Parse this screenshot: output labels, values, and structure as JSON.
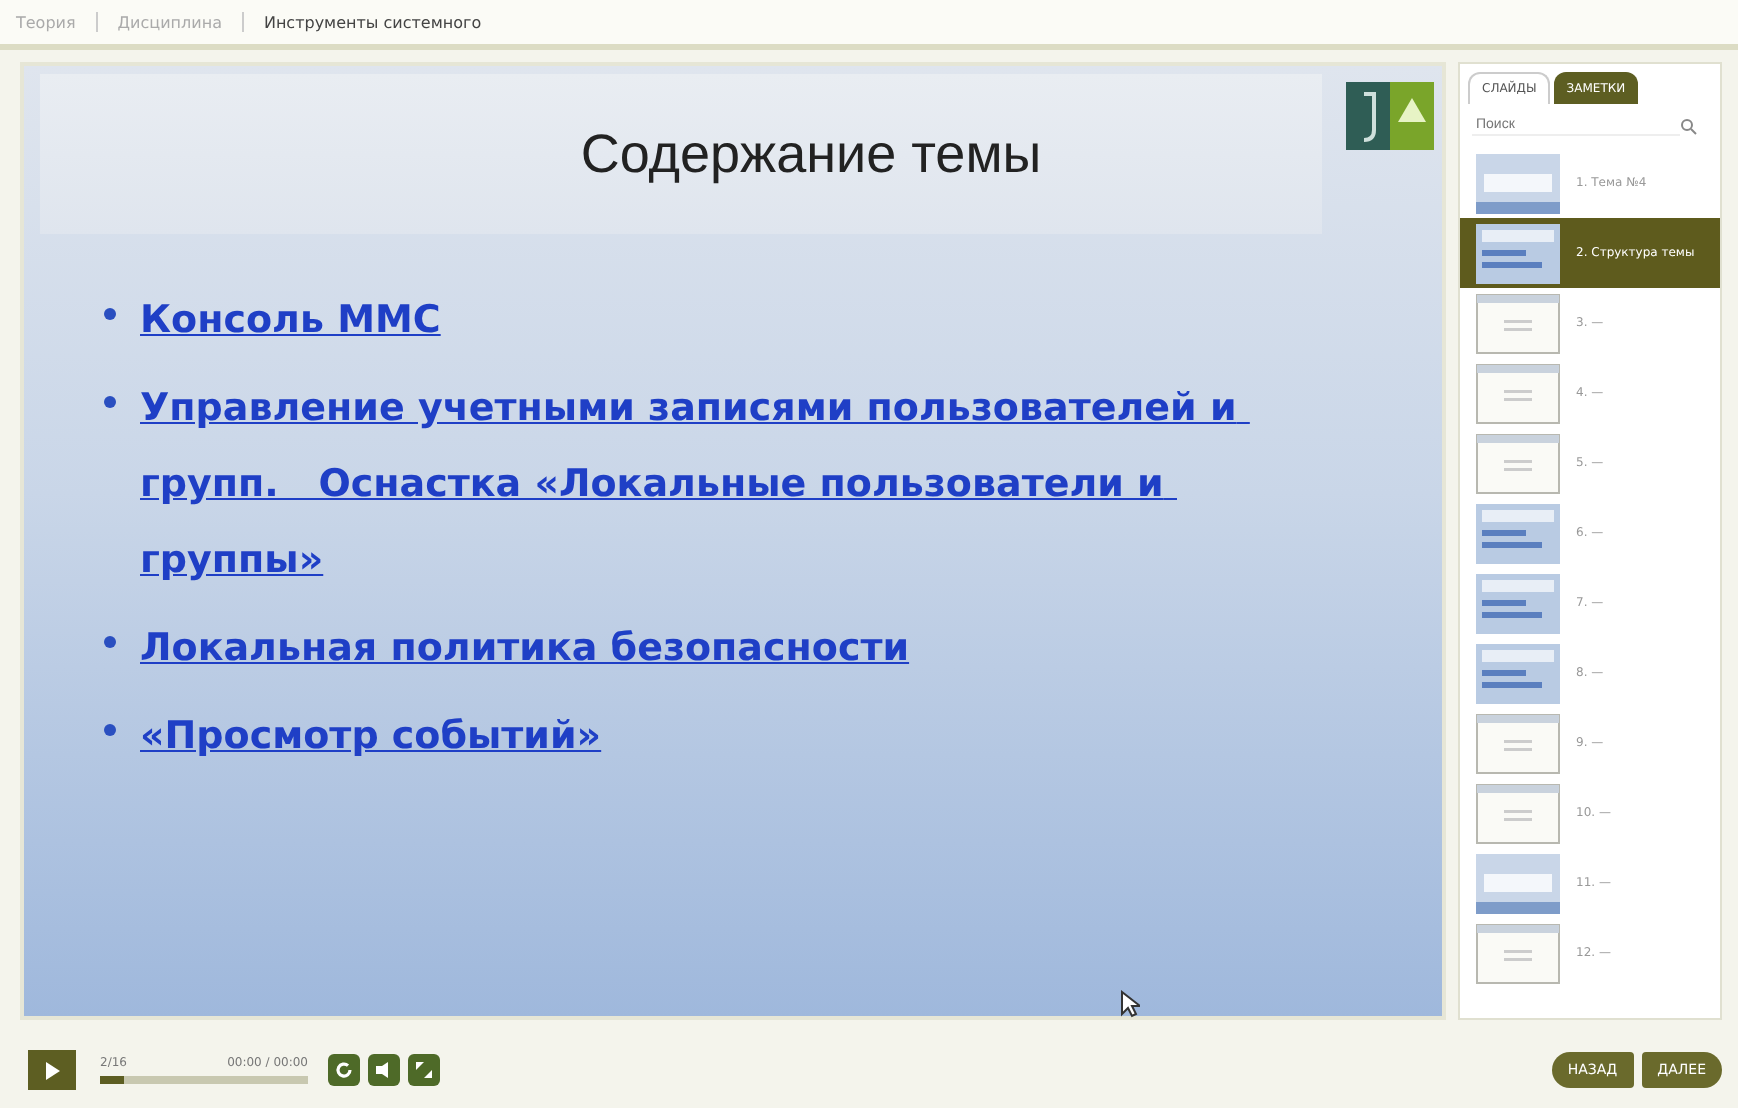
{
  "breadcrumbs": [
    {
      "label": "Теория",
      "selected": false
    },
    {
      "label": "Дисциплина",
      "selected": false
    },
    {
      "label": "Инструменты системного",
      "selected": true
    }
  ],
  "slide": {
    "title": "Содержание темы",
    "bullets": [
      "Консоль ММС",
      "Управление учетными записями пользователей и групп.   Оснастка «Локальные пользователи и группы»",
      "Локальная политика безопасности",
      "«Просмотр событий»"
    ]
  },
  "sidebar": {
    "tabs": [
      {
        "label": "СЛАЙДЫ",
        "selected": true
      },
      {
        "label": "ЗАМЕТКИ",
        "selected": false
      }
    ],
    "search": {
      "placeholder": "Поиск"
    },
    "slides": [
      {
        "label": "1. Тема №4",
        "kind": "title",
        "selected": false
      },
      {
        "label": "2. Структура темы",
        "kind": "blue",
        "selected": true
      },
      {
        "label": "3. —",
        "kind": "plain",
        "selected": false
      },
      {
        "label": "4. —",
        "kind": "plain",
        "selected": false
      },
      {
        "label": "5. —",
        "kind": "plain",
        "selected": false
      },
      {
        "label": "6. —",
        "kind": "blue",
        "selected": false
      },
      {
        "label": "7. —",
        "kind": "blue",
        "selected": false
      },
      {
        "label": "8. —",
        "kind": "blue",
        "selected": false
      },
      {
        "label": "9. —",
        "kind": "plain",
        "selected": false
      },
      {
        "label": "10. —",
        "kind": "plain",
        "selected": false
      },
      {
        "label": "11. —",
        "kind": "title",
        "selected": false
      },
      {
        "label": "12. —",
        "kind": "plain",
        "selected": false
      }
    ]
  },
  "player": {
    "position": "2/16",
    "time": "00:00 / 00:00",
    "level": 0.12,
    "back": "НАЗАД",
    "next": "ДАЛЕЕ"
  }
}
